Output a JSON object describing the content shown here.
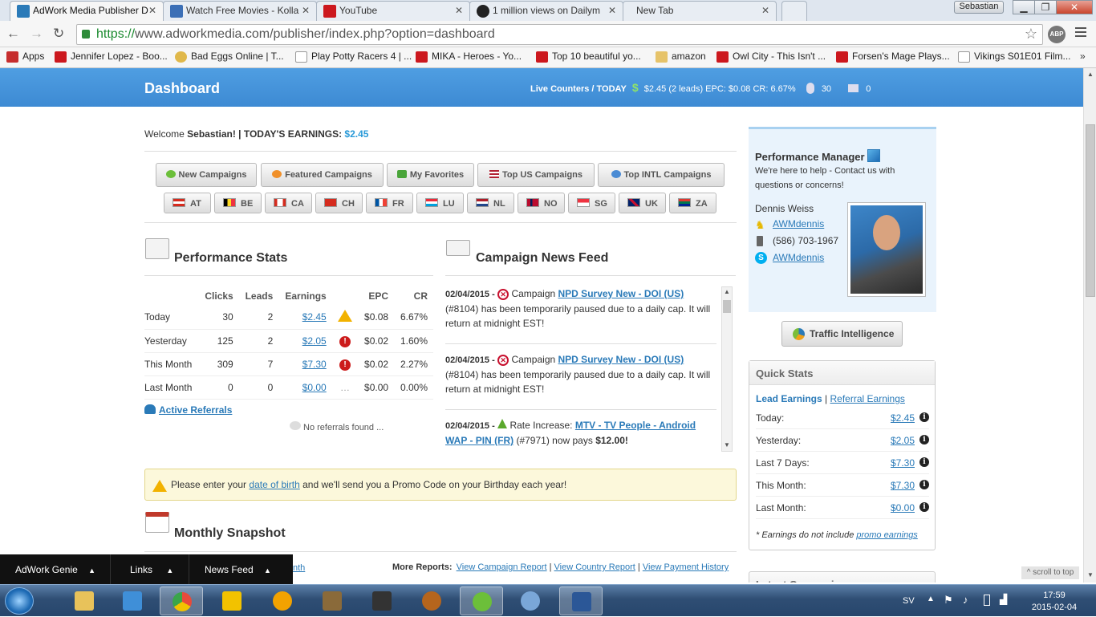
{
  "browser": {
    "tabs": [
      {
        "label": "AdWork Media Publisher D",
        "color": "#2a7ab8"
      },
      {
        "label": "Watch Free Movies - Kolla",
        "color": "#3b6fb6"
      },
      {
        "label": "YouTube",
        "color": "#cc181e"
      },
      {
        "label": "1 million views on Dailym",
        "color": "#222222"
      },
      {
        "label": "New Tab",
        "color": ""
      }
    ],
    "profile": "Sebastian",
    "url_https": "https://",
    "url_rest": "www.adworkmedia.com/publisher/index.php?option=dashboard",
    "abp": "ABP",
    "bookmarks": [
      {
        "label": "Apps",
        "icon": "apps-icon",
        "color": "#c62d2d"
      },
      {
        "label": "Jennifer Lopez - Boo...",
        "icon": "youtube-icon",
        "color": "#cc181e"
      },
      {
        "label": "Bad Eggs Online | T...",
        "icon": "egg-icon",
        "color": "#e0b84a"
      },
      {
        "label": "Play Potty Racers 4 | ...",
        "icon": "page-icon",
        "color": "#dddddd"
      },
      {
        "label": "MIKA - Heroes - Yo...",
        "icon": "youtube-icon",
        "color": "#cc181e"
      },
      {
        "label": "Top 10 beautiful yo...",
        "icon": "youtube-icon",
        "color": "#cc181e"
      },
      {
        "label": "amazon",
        "icon": "folder-icon",
        "color": "#e6c36a"
      },
      {
        "label": "Owl City - This Isn't ...",
        "icon": "youtube-icon",
        "color": "#cc181e"
      },
      {
        "label": "Forsen's Mage Plays...",
        "icon": "youtube-icon",
        "color": "#cc181e"
      },
      {
        "label": "Vikings S01E01 Film...",
        "icon": "page-icon",
        "color": "#dddddd"
      }
    ]
  },
  "header": {
    "title": "Dashboard",
    "live_label": "Live Counters / TODAY",
    "live_value": "$2.45 (2 leads) EPC: $0.08 CR: 6.67%",
    "clicks": "30",
    "leads": "0"
  },
  "welcome": {
    "prefix": "Welcome",
    "name": "Sebastian!",
    "earnings_label": "| TODAY'S EARNINGS:",
    "earnings_value": "$2.45"
  },
  "campaign_buttons": [
    {
      "label": "New Campaigns",
      "color": "#6cbf3a"
    },
    {
      "label": "Featured Campaigns",
      "color": "#f0902a"
    },
    {
      "label": "My Favorites",
      "color": "#4aa53a"
    },
    {
      "label": "Top US Campaigns",
      "color": "#8e9fc8"
    },
    {
      "label": "Top INTL Campaigns",
      "color": "#4a8bd4"
    }
  ],
  "country_buttons": [
    {
      "code": "AT",
      "c1": "#d52b1e",
      "c2": "#ffffff"
    },
    {
      "code": "BE",
      "c1": "#000000",
      "c2": "#fdda24"
    },
    {
      "code": "CA",
      "c1": "#d52b1e",
      "c2": "#ffffff"
    },
    {
      "code": "CH",
      "c1": "#d52b1e",
      "c2": "#d52b1e"
    },
    {
      "code": "FR",
      "c1": "#0055a4",
      "c2": "#ef4135"
    },
    {
      "code": "LU",
      "c1": "#ed2939",
      "c2": "#00a1de"
    },
    {
      "code": "NL",
      "c1": "#ae1c28",
      "c2": "#21468b"
    },
    {
      "code": "NO",
      "c1": "#ba0c2f",
      "c2": "#00205b"
    },
    {
      "code": "SG",
      "c1": "#ef3340",
      "c2": "#ffffff"
    },
    {
      "code": "UK",
      "c1": "#012169",
      "c2": "#c8102e"
    },
    {
      "code": "ZA",
      "c1": "#007a4d",
      "c2": "#ffb612"
    }
  ],
  "performance": {
    "title": "Performance Stats",
    "headers": [
      "",
      "Clicks",
      "Leads",
      "Earnings",
      "",
      "EPC",
      "CR"
    ],
    "rows": [
      {
        "period": "Today",
        "clicks": "30",
        "leads": "2",
        "earnings": "$2.45",
        "status": "warn",
        "epc": "$0.08",
        "cr": "6.67%"
      },
      {
        "period": "Yesterday",
        "clicks": "125",
        "leads": "2",
        "earnings": "$2.05",
        "status": "err",
        "epc": "$0.02",
        "cr": "1.60%"
      },
      {
        "period": "This Month",
        "clicks": "309",
        "leads": "7",
        "earnings": "$7.30",
        "status": "err",
        "epc": "$0.02",
        "cr": "2.27%"
      },
      {
        "period": "Last Month",
        "clicks": "0",
        "leads": "0",
        "earnings": "$0.00",
        "status": "dots",
        "epc": "$0.00",
        "cr": "0.00%"
      }
    ],
    "active_referrals": "Active Referrals",
    "no_referrals": "No referrals found ..."
  },
  "news": {
    "title": "Campaign News Feed",
    "items": [
      {
        "date": "02/04/2015 -",
        "type": "paused",
        "prefix": "Campaign",
        "link": "NPD Survey New - DOI (US)",
        "text": "(#8104) has been temporarily paused due to a daily cap. It will return at midnight EST!"
      },
      {
        "date": "02/04/2015 -",
        "type": "paused",
        "prefix": "Campaign",
        "link": "NPD Survey New - DOI (US)",
        "text": "(#8104) has been temporarily paused due to a daily cap. It will return at midnight EST!"
      },
      {
        "date": "02/04/2015 -",
        "type": "increase",
        "prefix": "Rate Increase:",
        "link": "MTV - TV People - Android WAP - PIN (FR)",
        "text": "(#7971) now pays",
        "amount": "$12.00!"
      }
    ]
  },
  "birthday": {
    "before": "Please enter your",
    "link": "date of birth",
    "after": "and we'll send you a Promo Code on your Birthday each year!"
  },
  "monthly": {
    "title": "Monthly Snapshot",
    "partial_link": "nth",
    "more_reports": "More Reports:",
    "reports": [
      "View Campaign Report",
      "View Country Report",
      "View Payment History"
    ]
  },
  "manager": {
    "title": "Performance Manager",
    "desc": "We're here to help - Contact us with questions or concerns!",
    "name": "Dennis Weiss",
    "aim": "AWMdennis",
    "phone": "(586) 703-1967",
    "skype": "AWMdennis"
  },
  "traffic_intelligence": "Traffic Intelligence",
  "quick_stats": {
    "title": "Quick Stats",
    "tab_active": "Lead Earnings",
    "tab_sep": "|",
    "tab_other": "Referral Earnings",
    "rows": [
      {
        "label": "Today:",
        "value": "$2.45"
      },
      {
        "label": "Yesterday:",
        "value": "$2.05"
      },
      {
        "label": "Last 7 Days:",
        "value": "$7.30"
      },
      {
        "label": "This Month:",
        "value": "$7.30"
      },
      {
        "label": "Last Month:",
        "value": "$0.00"
      }
    ],
    "note_prefix": "* Earnings do not include",
    "note_link": "promo earnings"
  },
  "latest_conversions": "Latest Conversions",
  "scroll_to_top": "^ scroll to top",
  "genie_bar": [
    "AdWork Genie",
    "Links",
    "News Feed"
  ],
  "taskbar": {
    "lang": "SV",
    "time": "17:59",
    "date": "2015-02-04",
    "apps": [
      {
        "name": "explorer-icon",
        "color": "#e8c25a",
        "active": false
      },
      {
        "name": "media-player-icon",
        "color": "#3f8fd8",
        "active": false
      },
      {
        "name": "chrome-icon",
        "color": "#e84a3a",
        "active": true
      },
      {
        "name": "ie-icon",
        "color": "#f2c200",
        "active": false
      },
      {
        "name": "audacity-icon",
        "color": "#f2a200",
        "active": false
      },
      {
        "name": "game-icon",
        "color": "#8a6a3a",
        "active": false
      },
      {
        "name": "dti-icon",
        "color": "#333333",
        "active": false
      },
      {
        "name": "squirrel-icon",
        "color": "#b5651d",
        "active": false
      },
      {
        "name": "utorrent-icon",
        "color": "#6cbf3a",
        "active": true
      },
      {
        "name": "paint-icon",
        "color": "#7aa7d8",
        "active": false
      },
      {
        "name": "word-icon",
        "color": "#2b5797",
        "active": true
      }
    ]
  }
}
